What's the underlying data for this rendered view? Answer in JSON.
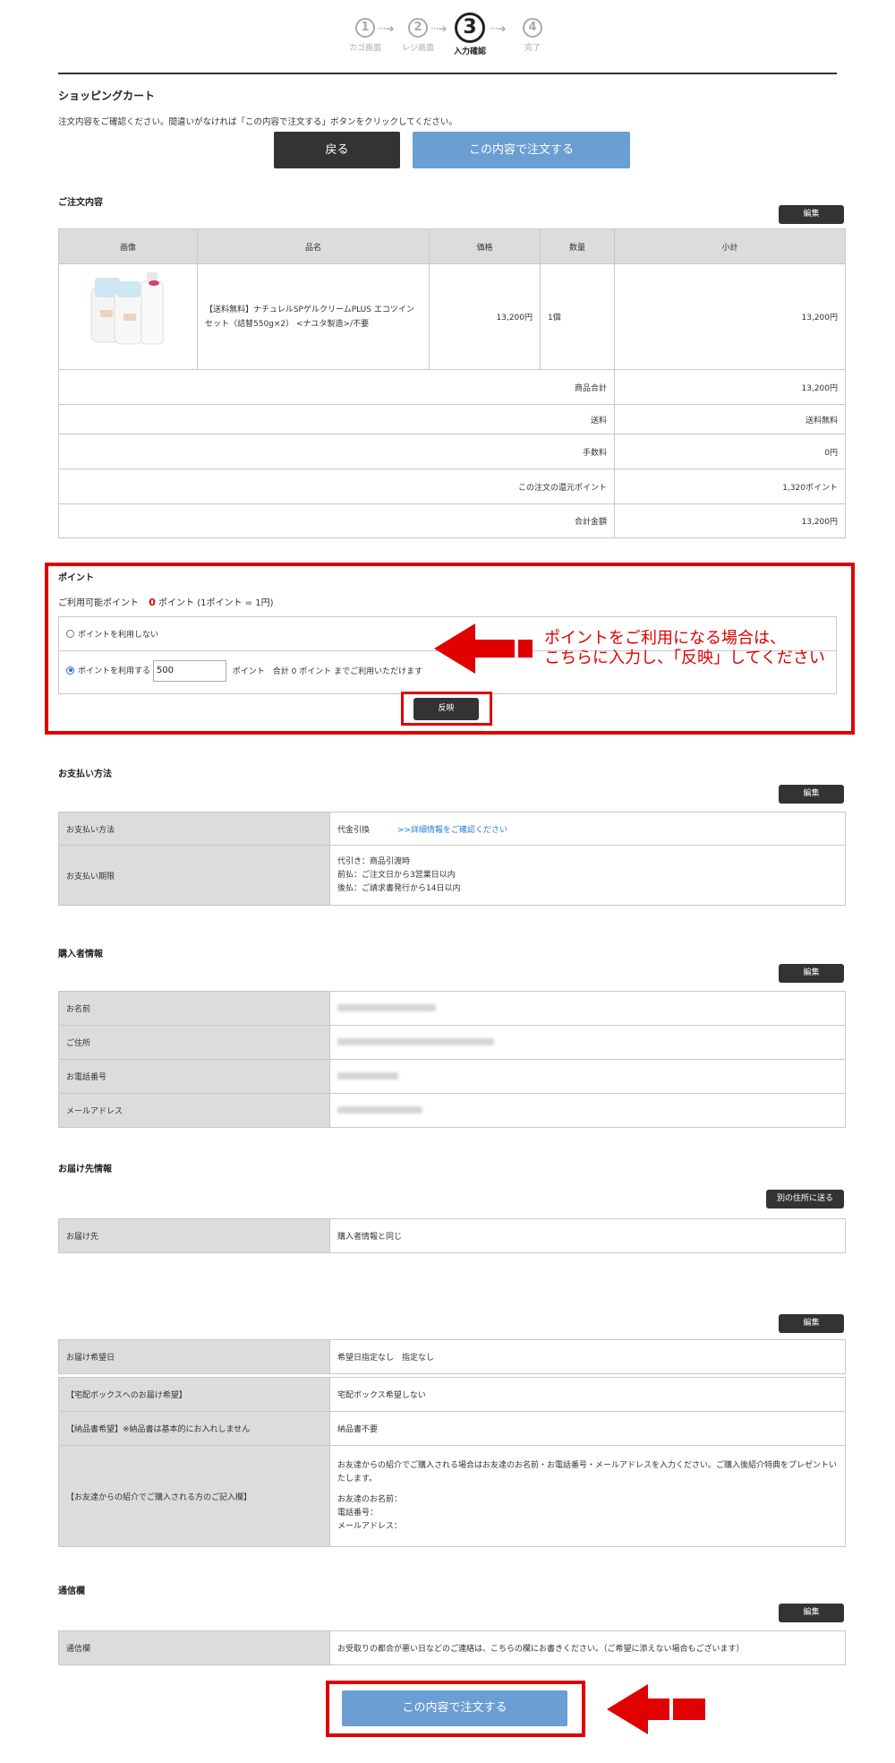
{
  "steps": [
    {
      "num": "1",
      "label": "カゴ画面"
    },
    {
      "num": "2",
      "label": "レジ画面"
    },
    {
      "num": "3",
      "label": "入力確認"
    },
    {
      "num": "4",
      "label": "完了"
    }
  ],
  "cart": {
    "title": "ショッピングカート",
    "note": "注文内容をご確認ください。間違いがなければ「この内容で注文する」ボタンをクリックしてください。",
    "back_button": "戻る",
    "order_button": "この内容で注文する"
  },
  "order": {
    "title": "ご注文内容",
    "edit_label": "編集",
    "headers": [
      "画像",
      "品名",
      "価格",
      "数量",
      "小計"
    ],
    "item": {
      "name": "【送料無料】ナチュレルSPゲルクリームPLUS エコツインセット（詰替550g×2） <ナユタ製造>/不要",
      "price": "13,200円",
      "qty": "1個",
      "subtotal": "13,200円"
    },
    "summary": [
      {
        "label": "商品合計",
        "value": "13,200円"
      },
      {
        "label": "送料",
        "value": "送料無料"
      },
      {
        "label": "手数料",
        "value": "0円"
      },
      {
        "label": "この注文の還元ポイント",
        "value": "1,320ポイント"
      },
      {
        "label": "合計金額",
        "value": "13,200円"
      }
    ]
  },
  "points": {
    "title": "ポイント",
    "available_prefix": "ご利用可能ポイント",
    "available_value": "0",
    "available_suffix": "ポイント (1ポイント = 1円)",
    "option_none": "ポイントを利用しない",
    "option_use": "ポイントを利用する",
    "input_value": "500",
    "after_input": "ポイント　合計 0 ポイント までご利用いただけます",
    "apply_button": "反映",
    "annotation_line1": "ポイントをご利用になる場合は、",
    "annotation_line2": "こちらに入力し、「反映」してください"
  },
  "payment": {
    "title": "お支払い方法",
    "edit_label": "編集",
    "method_label": "お支払い方法",
    "method_value": "代金引換",
    "method_link": ">>詳細情報をご確認ください",
    "deadline_label": "お支払い期限",
    "deadline_lines": [
      "代引き：商品引渡時",
      "前払：ご注文日から3営業日以内",
      "後払：ご請求書発行から14日以内"
    ]
  },
  "buyer": {
    "title": "購入者情報",
    "edit_label": "編集",
    "rows": [
      {
        "label": "お名前"
      },
      {
        "label": "ご住所"
      },
      {
        "label": "お電話番号"
      },
      {
        "label": "メールアドレス"
      }
    ]
  },
  "delivery": {
    "title": "お届け先情報",
    "other_address_button": "別の住所に送る",
    "dest_label": "お届け先",
    "dest_value": "購入者情報と同じ"
  },
  "options": {
    "edit_label": "編集",
    "date_label": "お届け希望日",
    "date_value": "希望日指定なし　指定なし",
    "box_label": "【宅配ボックスへのお届け希望】",
    "box_value": "宅配ボックス希望しない",
    "invoice_label": "【納品書希望】※納品書は基本的にお入れしません",
    "invoice_value": "納品書不要",
    "referral_label": "【お友達からの紹介でご購入される方のご記入欄】",
    "referral_text": "お友達からの紹介でご購入される場合はお友達のお名前・お電話番号・メールアドレスを入力ください。ご購入後紹介特典をプレゼントいたします。",
    "referral_fields": [
      "お友達のお名前：",
      "電話番号：",
      "メールアドレス："
    ]
  },
  "message": {
    "title": "通信欄",
    "edit_label": "編集",
    "label": "通信欄",
    "value": "お受取りの都合が悪い日などのご連絡は、こちらの欄にお書きください。（ご希望に添えない場合もございます）"
  },
  "bottom_order_button": "この内容で注文する",
  "colors": {
    "accent_blue": "#6b9ed3",
    "annotation_red": "#e00000",
    "dark_button": "#333333"
  }
}
